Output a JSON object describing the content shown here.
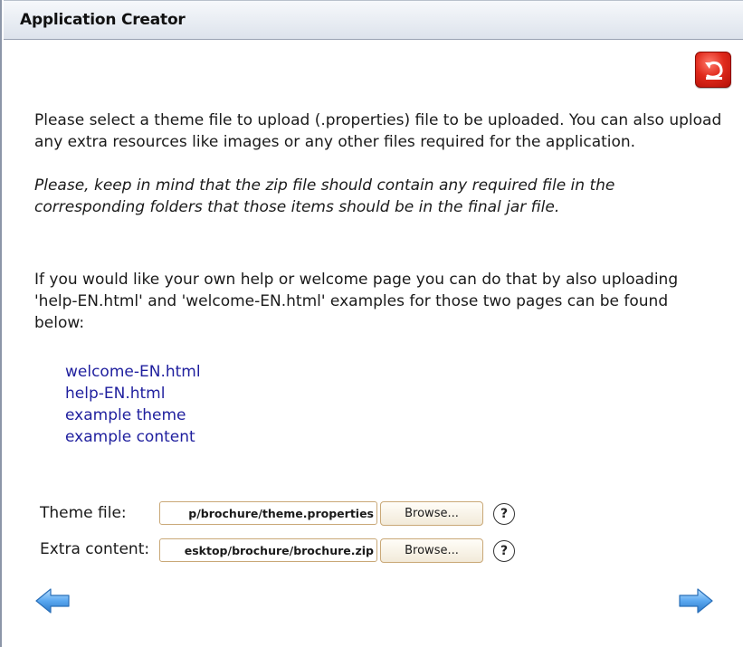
{
  "window": {
    "title": "Application Creator"
  },
  "instructions": {
    "paragraph1": "Please select a theme file to upload (.properties) file to be uploaded. You can also upload any extra resources like images or any other files required for the application.",
    "paragraph2": "Please, keep in mind that the zip file should contain any required file in the corresponding folders that those items should be in the final jar file.",
    "paragraph3": "If you would like your own help or welcome page you can do that by also uploading 'help-EN.html' and 'welcome-EN.html' examples for those two pages can be found below:"
  },
  "links": [
    {
      "label": "welcome-EN.html"
    },
    {
      "label": "help-EN.html"
    },
    {
      "label": "example theme"
    },
    {
      "label": "example content"
    }
  ],
  "form": {
    "theme": {
      "label": "Theme file:",
      "value": "p/brochure/theme.properties",
      "browse_label": "Browse...",
      "help_label": "?"
    },
    "extra": {
      "label": "Extra content:",
      "value": "esktop/brochure/brochure.zip",
      "browse_label": "Browse...",
      "help_label": "?"
    }
  },
  "icons": {
    "undo": "undo-icon",
    "back": "arrow-left-icon",
    "next": "arrow-right-icon"
  },
  "colors": {
    "link": "#1f1f9e",
    "field_border": "#c9a877",
    "undo_red": "#e02a1c",
    "arrow_blue": "#5aa8f0"
  }
}
